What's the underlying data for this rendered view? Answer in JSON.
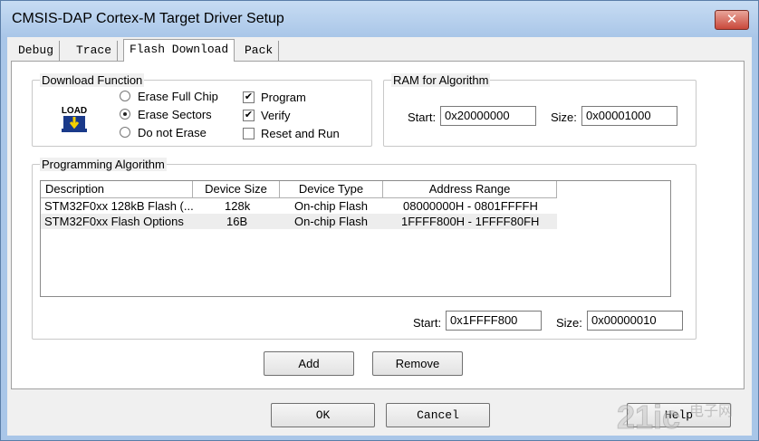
{
  "window": {
    "title": "CMSIS-DAP Cortex-M Target Driver Setup",
    "close_glyph": "✕"
  },
  "tabs": [
    {
      "label": "Debug"
    },
    {
      "label": "Trace"
    },
    {
      "label": "Flash Download"
    },
    {
      "label": "Pack"
    }
  ],
  "download_function": {
    "legend": "Download Function",
    "icon_text": "LOAD",
    "radios": [
      {
        "label": "Erase Full Chip",
        "selected": false
      },
      {
        "label": "Erase Sectors",
        "selected": true
      },
      {
        "label": "Do not Erase",
        "selected": false
      }
    ],
    "checks": [
      {
        "label": "Program",
        "checked": true,
        "mark": "✔"
      },
      {
        "label": "Verify",
        "checked": true,
        "mark": "✔"
      },
      {
        "label": "Reset and Run",
        "checked": false,
        "mark": ""
      }
    ]
  },
  "ram": {
    "legend": "RAM for Algorithm",
    "start_label": "Start:",
    "start_value": "0x20000000",
    "size_label": "Size:",
    "size_value": "0x00001000"
  },
  "algorithm": {
    "legend": "Programming Algorithm",
    "columns": [
      "Description",
      "Device Size",
      "Device Type",
      "Address Range"
    ],
    "rows": [
      {
        "description": "STM32F0xx 128kB Flash (...",
        "size": "128k",
        "type": "On-chip Flash",
        "range": "08000000H - 0801FFFFH"
      },
      {
        "description": "STM32F0xx Flash Options",
        "size": "16B",
        "type": "On-chip Flash",
        "range": "1FFFF800H - 1FFFF80FH"
      }
    ],
    "start_label": "Start:",
    "start_value": "0x1FFFF800",
    "size_label": "Size:",
    "size_value": "0x00000010"
  },
  "buttons": {
    "add": "Add",
    "remove": "Remove",
    "ok": "OK",
    "cancel": "Cancel",
    "help": "Help"
  },
  "watermark": {
    "text": "21ic",
    "sub": "电子网"
  }
}
